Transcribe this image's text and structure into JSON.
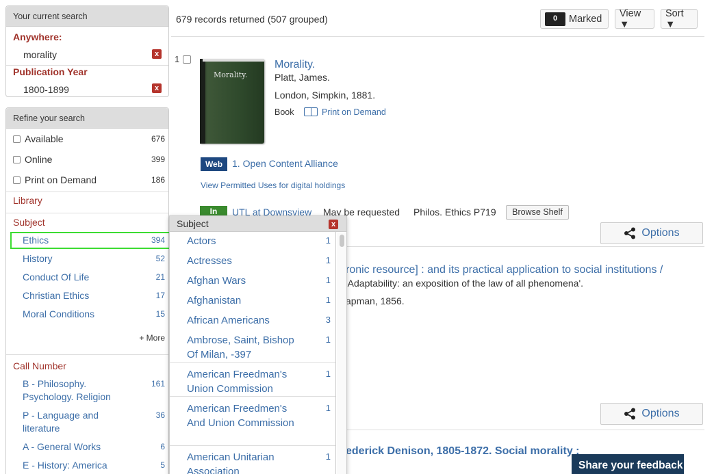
{
  "current_search": {
    "heading": "Your current search",
    "criteria": [
      {
        "field": "Anywhere:",
        "value": "morality"
      },
      {
        "field": "Publication Year",
        "value": "1800-1899"
      }
    ],
    "remove_glyph": "x"
  },
  "refine": {
    "heading": "Refine your search",
    "checkboxes": [
      {
        "label": "Available",
        "count": "676"
      },
      {
        "label": "Online",
        "count": "399"
      },
      {
        "label": "Print on Demand",
        "count": "186"
      }
    ],
    "library_label": "Library",
    "subject_label": "Subject",
    "subjects": [
      {
        "label": "Ethics",
        "count": "394"
      },
      {
        "label": "History",
        "count": "52"
      },
      {
        "label": "Conduct Of Life",
        "count": "21"
      },
      {
        "label": "Christian Ethics",
        "count": "17"
      },
      {
        "label": "Moral Conditions",
        "count": "15"
      }
    ],
    "more_label": "+ More",
    "call_number_label": "Call Number",
    "call_numbers": [
      {
        "label": "B - Philosophy. Psychology. Religion",
        "count": "161"
      },
      {
        "label": "P - Language and literature",
        "count": "36"
      },
      {
        "label": "A - General Works",
        "count": "6"
      },
      {
        "label": "E - History: America",
        "count": "5"
      }
    ]
  },
  "header": {
    "records_text": "679 records returned (507 grouped)",
    "marked_count": "0",
    "marked_label": "Marked",
    "view_label": "View ▼",
    "sort_label": "Sort ▼"
  },
  "record1": {
    "number": "1",
    "cover_title": "Morality.",
    "title": "Morality.",
    "author": "Platt, James.",
    "publication": "London, Simpkin, 1881.",
    "format": "Book",
    "print_on_demand": "Print on Demand",
    "web_badge": "Web",
    "online_link": "1. Open Content Alliance",
    "permitted_link": "View Permitted Uses for digital holdings",
    "in_badge": "In",
    "location": "UTL at Downsview",
    "request_text": "May be requested",
    "call_number": "Philos. Ethics P719",
    "browse_shelf": "Browse Shelf",
    "options_label": "Options"
  },
  "record2": {
    "title_fragment": "ronic resource] : and its practical application to social institutions /",
    "note_fragment": "'Adaptability: an exposition of the law of all phenomena'.",
    "publication_fragment": "apman, 1856.",
    "options_label": "Options"
  },
  "record3": {
    "title_fragment": "ederick Denison, 1805-1872. Social morality :"
  },
  "feedback_label": "Share your feedback",
  "subject_popup": {
    "heading": "Subject",
    "items": [
      {
        "label": "Actors",
        "count": "1"
      },
      {
        "label": "Actresses",
        "count": "1"
      },
      {
        "label": "Afghan Wars",
        "count": "1"
      },
      {
        "label": "Afghanistan",
        "count": "1"
      },
      {
        "label": "African Americans",
        "count": "3"
      },
      {
        "label": "Ambrose, Saint, Bishop Of Milan, -397",
        "count": "1"
      },
      {
        "label": "American Freedman's Union Commission",
        "count": "1"
      },
      {
        "label": "American Freedmen's And Union Commission",
        "count": "1"
      },
      {
        "label": "American Unitarian Association",
        "count": "1"
      }
    ]
  },
  "colors": {
    "link": "#3c6ea8",
    "section_label": "#a0332b",
    "highlight": "#3cdc32",
    "web_badge": "#1e4880",
    "in_badge": "#3a8a2e",
    "feedback": "#1a3a5a"
  }
}
